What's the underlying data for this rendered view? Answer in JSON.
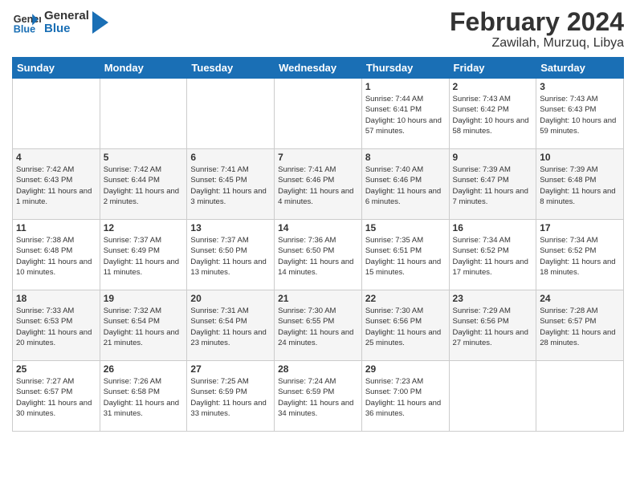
{
  "header": {
    "logo_general": "General",
    "logo_blue": "Blue",
    "title": "February 2024",
    "subtitle": "Zawilah, Murzuq, Libya"
  },
  "days_of_week": [
    "Sunday",
    "Monday",
    "Tuesday",
    "Wednesday",
    "Thursday",
    "Friday",
    "Saturday"
  ],
  "weeks": [
    [
      {
        "day": "",
        "info": ""
      },
      {
        "day": "",
        "info": ""
      },
      {
        "day": "",
        "info": ""
      },
      {
        "day": "",
        "info": ""
      },
      {
        "day": "1",
        "info": "Sunrise: 7:44 AM\nSunset: 6:41 PM\nDaylight: 10 hours and 57 minutes."
      },
      {
        "day": "2",
        "info": "Sunrise: 7:43 AM\nSunset: 6:42 PM\nDaylight: 10 hours and 58 minutes."
      },
      {
        "day": "3",
        "info": "Sunrise: 7:43 AM\nSunset: 6:43 PM\nDaylight: 10 hours and 59 minutes."
      }
    ],
    [
      {
        "day": "4",
        "info": "Sunrise: 7:42 AM\nSunset: 6:43 PM\nDaylight: 11 hours and 1 minute."
      },
      {
        "day": "5",
        "info": "Sunrise: 7:42 AM\nSunset: 6:44 PM\nDaylight: 11 hours and 2 minutes."
      },
      {
        "day": "6",
        "info": "Sunrise: 7:41 AM\nSunset: 6:45 PM\nDaylight: 11 hours and 3 minutes."
      },
      {
        "day": "7",
        "info": "Sunrise: 7:41 AM\nSunset: 6:46 PM\nDaylight: 11 hours and 4 minutes."
      },
      {
        "day": "8",
        "info": "Sunrise: 7:40 AM\nSunset: 6:46 PM\nDaylight: 11 hours and 6 minutes."
      },
      {
        "day": "9",
        "info": "Sunrise: 7:39 AM\nSunset: 6:47 PM\nDaylight: 11 hours and 7 minutes."
      },
      {
        "day": "10",
        "info": "Sunrise: 7:39 AM\nSunset: 6:48 PM\nDaylight: 11 hours and 8 minutes."
      }
    ],
    [
      {
        "day": "11",
        "info": "Sunrise: 7:38 AM\nSunset: 6:48 PM\nDaylight: 11 hours and 10 minutes."
      },
      {
        "day": "12",
        "info": "Sunrise: 7:37 AM\nSunset: 6:49 PM\nDaylight: 11 hours and 11 minutes."
      },
      {
        "day": "13",
        "info": "Sunrise: 7:37 AM\nSunset: 6:50 PM\nDaylight: 11 hours and 13 minutes."
      },
      {
        "day": "14",
        "info": "Sunrise: 7:36 AM\nSunset: 6:50 PM\nDaylight: 11 hours and 14 minutes."
      },
      {
        "day": "15",
        "info": "Sunrise: 7:35 AM\nSunset: 6:51 PM\nDaylight: 11 hours and 15 minutes."
      },
      {
        "day": "16",
        "info": "Sunrise: 7:34 AM\nSunset: 6:52 PM\nDaylight: 11 hours and 17 minutes."
      },
      {
        "day": "17",
        "info": "Sunrise: 7:34 AM\nSunset: 6:52 PM\nDaylight: 11 hours and 18 minutes."
      }
    ],
    [
      {
        "day": "18",
        "info": "Sunrise: 7:33 AM\nSunset: 6:53 PM\nDaylight: 11 hours and 20 minutes."
      },
      {
        "day": "19",
        "info": "Sunrise: 7:32 AM\nSunset: 6:54 PM\nDaylight: 11 hours and 21 minutes."
      },
      {
        "day": "20",
        "info": "Sunrise: 7:31 AM\nSunset: 6:54 PM\nDaylight: 11 hours and 23 minutes."
      },
      {
        "day": "21",
        "info": "Sunrise: 7:30 AM\nSunset: 6:55 PM\nDaylight: 11 hours and 24 minutes."
      },
      {
        "day": "22",
        "info": "Sunrise: 7:30 AM\nSunset: 6:56 PM\nDaylight: 11 hours and 25 minutes."
      },
      {
        "day": "23",
        "info": "Sunrise: 7:29 AM\nSunset: 6:56 PM\nDaylight: 11 hours and 27 minutes."
      },
      {
        "day": "24",
        "info": "Sunrise: 7:28 AM\nSunset: 6:57 PM\nDaylight: 11 hours and 28 minutes."
      }
    ],
    [
      {
        "day": "25",
        "info": "Sunrise: 7:27 AM\nSunset: 6:57 PM\nDaylight: 11 hours and 30 minutes."
      },
      {
        "day": "26",
        "info": "Sunrise: 7:26 AM\nSunset: 6:58 PM\nDaylight: 11 hours and 31 minutes."
      },
      {
        "day": "27",
        "info": "Sunrise: 7:25 AM\nSunset: 6:59 PM\nDaylight: 11 hours and 33 minutes."
      },
      {
        "day": "28",
        "info": "Sunrise: 7:24 AM\nSunset: 6:59 PM\nDaylight: 11 hours and 34 minutes."
      },
      {
        "day": "29",
        "info": "Sunrise: 7:23 AM\nSunset: 7:00 PM\nDaylight: 11 hours and 36 minutes."
      },
      {
        "day": "",
        "info": ""
      },
      {
        "day": "",
        "info": ""
      }
    ]
  ]
}
